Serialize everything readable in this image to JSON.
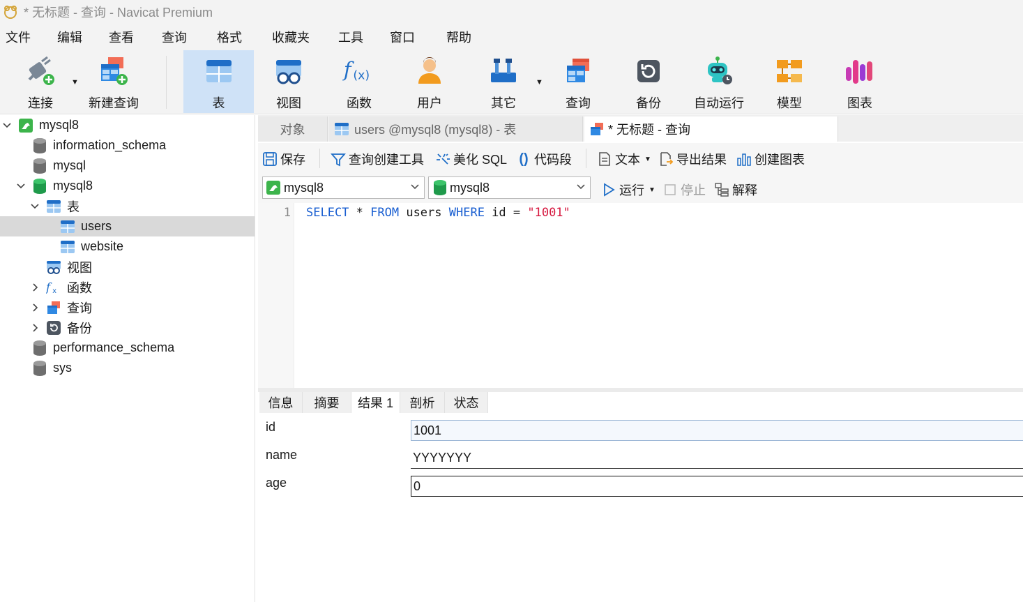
{
  "window": {
    "title": "* 无标题 - 查询 - Navicat Premium"
  },
  "menu": [
    "文件",
    "编辑",
    "查看",
    "查询",
    "格式",
    "收藏夹",
    "工具",
    "窗口",
    "帮助"
  ],
  "toolbar": {
    "connect": "连接",
    "new_query": "新建查询",
    "table": "表",
    "view": "视图",
    "function": "函数",
    "user": "用户",
    "other": "其它",
    "query": "查询",
    "backup": "备份",
    "automation": "自动运行",
    "model": "模型",
    "chart": "图表"
  },
  "sidebar": {
    "items": [
      {
        "label": "mysql8"
      },
      {
        "label": "information_schema"
      },
      {
        "label": "mysql"
      },
      {
        "label": "mysql8"
      },
      {
        "label": "表"
      },
      {
        "label": "users"
      },
      {
        "label": "website"
      },
      {
        "label": "视图"
      },
      {
        "label": "函数"
      },
      {
        "label": "查询"
      },
      {
        "label": "备份"
      },
      {
        "label": "performance_schema"
      },
      {
        "label": "sys"
      }
    ]
  },
  "tabs": {
    "objects": "对象",
    "users_table": "users @mysql8 (mysql8) - 表",
    "query": "* 无标题 - 查询"
  },
  "editor_toolbar": {
    "save": "保存",
    "query_builder": "查询创建工具",
    "beautify": "美化 SQL",
    "snippet": "代码段",
    "text": "文本",
    "export": "导出结果",
    "create_chart": "创建图表"
  },
  "connbar": {
    "connection": "mysql8",
    "database": "mysql8",
    "run": "运行",
    "stop": "停止",
    "explain": "解释"
  },
  "editor": {
    "line_number": "1",
    "tokens": {
      "select": "SELECT",
      "star": " * ",
      "from": "FROM",
      "table": " users ",
      "where": "WHERE",
      "cond": " id = ",
      "value": "\"1001\""
    }
  },
  "result_tabs": [
    "信息",
    "摘要",
    "结果 1",
    "剖析",
    "状态"
  ],
  "result": {
    "fields": [
      {
        "name": "id",
        "value": "1001"
      },
      {
        "name": "name",
        "value": "YYYYYYY"
      },
      {
        "name": "age",
        "value": "0"
      }
    ]
  },
  "colors": {
    "accent": "#1a5fd1",
    "string": "#d6183f",
    "active_tool_bg": "#cfe2f7",
    "selected_row_bg": "#d9d9d9"
  }
}
